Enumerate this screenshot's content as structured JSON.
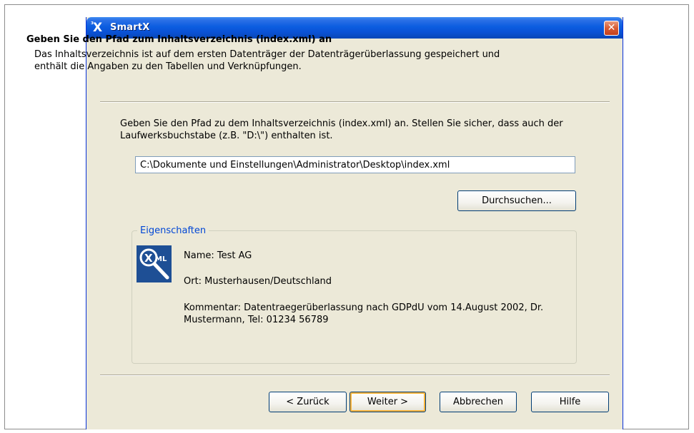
{
  "window": {
    "title": "SmartX",
    "logo": "X",
    "logo_sup": "³"
  },
  "header": {
    "title": "Geben Sie den Pfad zum Inhaltsverzeichnis (index.xml) an",
    "description": "Das Inhaltsverzeichnis ist auf dem ersten Datenträger der Datenträgerüberlassung gespeichert und enthält die Angaben zu den Tabellen und Verknüpfungen."
  },
  "body": {
    "instruction": "Geben Sie den Pfad zu dem Inhaltsverzeichnis (index.xml) an. Stellen Sie sicher, dass auch der Laufwerksbuchstabe (z.B. \"D:\\\") enthalten ist.",
    "path_value": "C:\\Dokumente und Einstellungen\\Administrator\\Desktop\\index.xml",
    "browse_label": "Durchsuchen..."
  },
  "properties": {
    "legend": "Eigenschaften",
    "name": "Name: Test AG",
    "ort": "Ort: Musterhausen/Deutschland",
    "kommentar": "Kommentar: Datentraegerüberlassung nach GDPdU vom 14.August 2002, Dr. Mustermann, Tel: 01234 56789"
  },
  "footer": {
    "back_label": "< Zurück",
    "next_label": "Weiter >",
    "cancel_label": "Abbrechen",
    "help_label": "Hilfe"
  }
}
